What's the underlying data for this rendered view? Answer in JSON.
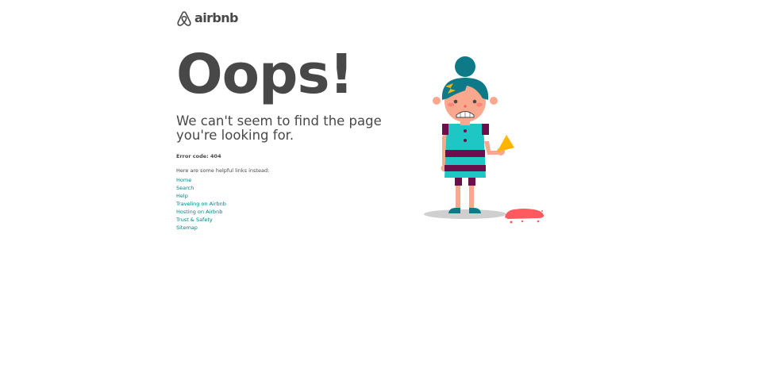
{
  "brand": {
    "name": "airbnb",
    "logo_icon": "belo-icon",
    "color": "#484848"
  },
  "main": {
    "headline": "Oops!",
    "subtitle": "We can't seem to find the page you're looking for.",
    "error_code": "Error code: 404",
    "links_intro": "Here are some helpful links instead:",
    "links": [
      "Home",
      "Search",
      "Help",
      "Traveling on Airbnb",
      "Hosting on Airbnb",
      "Trust & Safety",
      "Sitemap"
    ]
  },
  "illustration": {
    "name": "sad-girl-dropped-ice-cream",
    "colors": {
      "hair": "#0e7a87",
      "skin": "#f9a88e",
      "dress": "#1ec6c4",
      "stripes": "#6b0f4c",
      "cone": "#ffb400",
      "ice_cream": "#ff5a5f",
      "shadow": "#cfcfcf"
    }
  },
  "colors": {
    "text": "#484848",
    "link": "#008489",
    "background": "#ffffff"
  }
}
